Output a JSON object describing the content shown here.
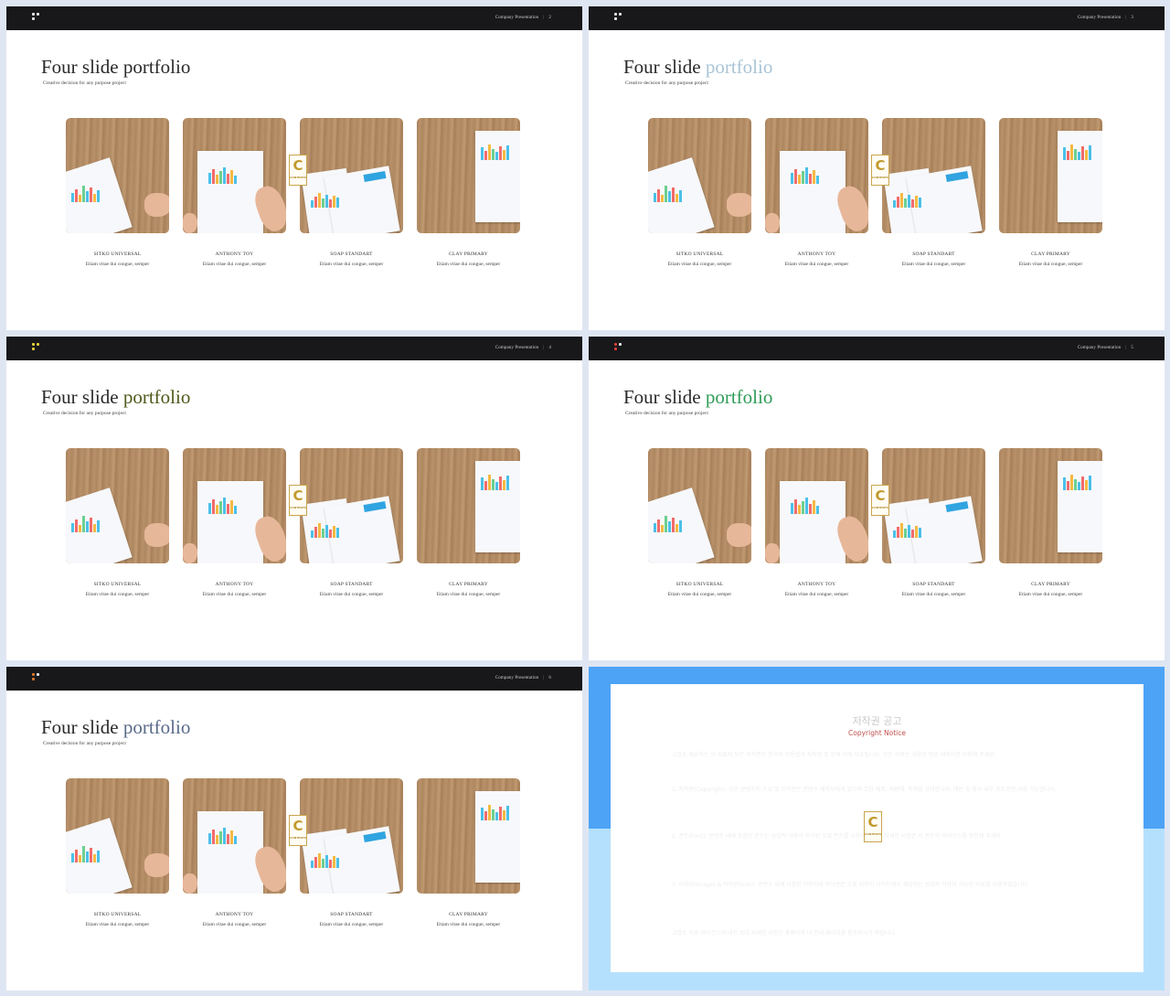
{
  "slides": [
    {
      "page": "2",
      "title_black": "Four slide",
      "title_accent": "portfolio",
      "accent_color": "#2a2a2a",
      "dot_colors": [
        "#e9e9e9",
        "#e9e9e9",
        "#e9e9e9"
      ]
    },
    {
      "page": "3",
      "title_black": "Four slide",
      "title_accent": "portfolio",
      "accent_color": "#a9c4d6",
      "dot_colors": [
        "#e9e9e9",
        "#e9e9e9",
        "#e9e9e9"
      ]
    },
    {
      "page": "4",
      "title_black": "Four slide",
      "title_accent": "portfolio",
      "accent_color": "#4f5a1b",
      "dot_colors": [
        "#e2cf3a",
        "#e2cf3a",
        "#e2cf3a"
      ]
    },
    {
      "page": "5",
      "title_black": "Four slide",
      "title_accent": "portfolio",
      "accent_color": "#2e9c58",
      "dot_colors": [
        "#e0413a",
        "#e9e9e9",
        "#e0413a"
      ]
    },
    {
      "page": "6",
      "title_black": "Four slide",
      "title_accent": "portfolio",
      "accent_color": "#5a6a8a",
      "dot_colors": [
        "#d9772a",
        "#e9e9e9",
        "#d9772a"
      ]
    }
  ],
  "common": {
    "presentation_label": "Company Presentation",
    "separator": "|",
    "subtitle": "Creative decision for any purpose project",
    "cards": [
      {
        "name": "SITKO UNIVERSAL",
        "desc": "Etiam vitae dui congue, semper"
      },
      {
        "name": "ANTHONY TOY",
        "desc": "Etiam vitae dui congue, semper"
      },
      {
        "name": "SOAP STANDART",
        "desc": "Etiam vitae dui congue, semper"
      },
      {
        "name": "CLAY PRIMARY",
        "desc": "Etiam vitae dui congue, semper"
      }
    ],
    "watermark_letter": "C",
    "watermark_text": "CONTENTS"
  },
  "notice": {
    "title": "저작권 공고",
    "subtitle": "Copyright Notice",
    "paragraphs": [
      "고맙소 제공하는 이 자료의 모든 저작권은 한국의 보통법과 저작권 법 등에 의해 보호됩니다. 모든 자료는 사용권 범위 내에서만 사용해 주세요.",
      "1. 저작권(Copyright): 모든 콘텐츠의 소유 및 저작권은 콘텐츠 제작자에게 있으며 무단 배포, 재판매, 복제를 금지합니다. 개인 및 회사 내부 용도로만 사용 가능합니다.",
      "2. 폰트(Font): 콘텐츠 내에 포함된 폰트는 상업적 사용이 허가된 무료 폰트를 사용하였으며, 자세한 사항은 각 폰트의 라이선스를 확인해 주세요.",
      "3. 이미지(Image) & 아이콘(Icon): 콘텐츠 내에 사용된 이미지와 아이콘은 무료 이미지 사이트에서 제공하는 상업적 이용이 가능한 자료를 사용하였습니다.",
      "고맙소 자료 라이선스에 대한 보다 자세한 사항은 홈페이지 내 안내 페이지를 참조하시기 바랍니다."
    ]
  }
}
